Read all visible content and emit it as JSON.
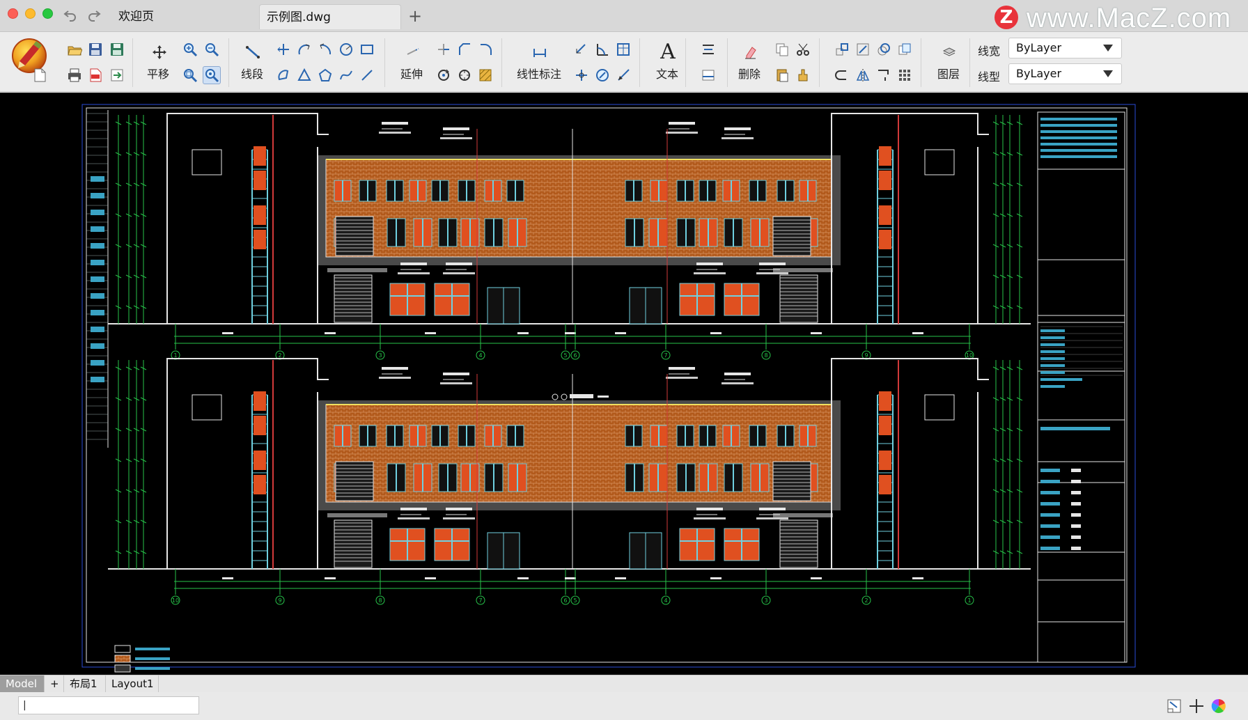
{
  "window": {
    "tabs": [
      {
        "label": "欢迎页"
      },
      {
        "label": "示例图.dwg",
        "active": true
      }
    ],
    "add_tab_label": "+",
    "watermark_text": "www.MacZ.com",
    "watermark_logo_letter": "Z"
  },
  "ribbon": {
    "labels": {
      "pan": "平移",
      "line": "线段",
      "extend": "延伸",
      "linear_dim": "线性标注",
      "text": "文本",
      "text_glyph": "A",
      "erase": "删除",
      "layer": "图层"
    },
    "properties": {
      "lineweight": {
        "label": "线宽",
        "value": "ByLayer"
      },
      "linetype": {
        "label": "线型",
        "value": "ByLayer"
      }
    }
  },
  "canvas": {
    "background": "#000000",
    "drawing": {
      "brick_color": "#b25a1c",
      "window_color": "#6fd0e0",
      "red_panel_color": "#e05020",
      "green_line_color": "#27c44a",
      "white_line_color": "#e6e6e6",
      "red_line_color": "#d23a3a",
      "blue_frame_color": "#2a4bd8",
      "top_elevation_axes": [
        "1",
        "2",
        "3",
        "4",
        "5",
        "6",
        "7",
        "8",
        "9",
        "10"
      ],
      "bottom_elevation_axes": [
        "10",
        "9",
        "8",
        "7",
        "6",
        "5",
        "4",
        "3",
        "2",
        "1"
      ]
    }
  },
  "layout_tabs": [
    {
      "label": "Model",
      "active": true
    },
    {
      "label": "+"
    },
    {
      "label": "布局1"
    },
    {
      "label": "Layout1"
    }
  ],
  "command": {
    "value": "|"
  },
  "status_icons": [
    "model-space-icon",
    "crosshair-icon",
    "color-wheel-icon"
  ],
  "colors": {
    "titlebar": "#d8d8d8",
    "ribbon": "#ececec",
    "canvas": "#000000",
    "layout_active": "#9e9e9e"
  }
}
